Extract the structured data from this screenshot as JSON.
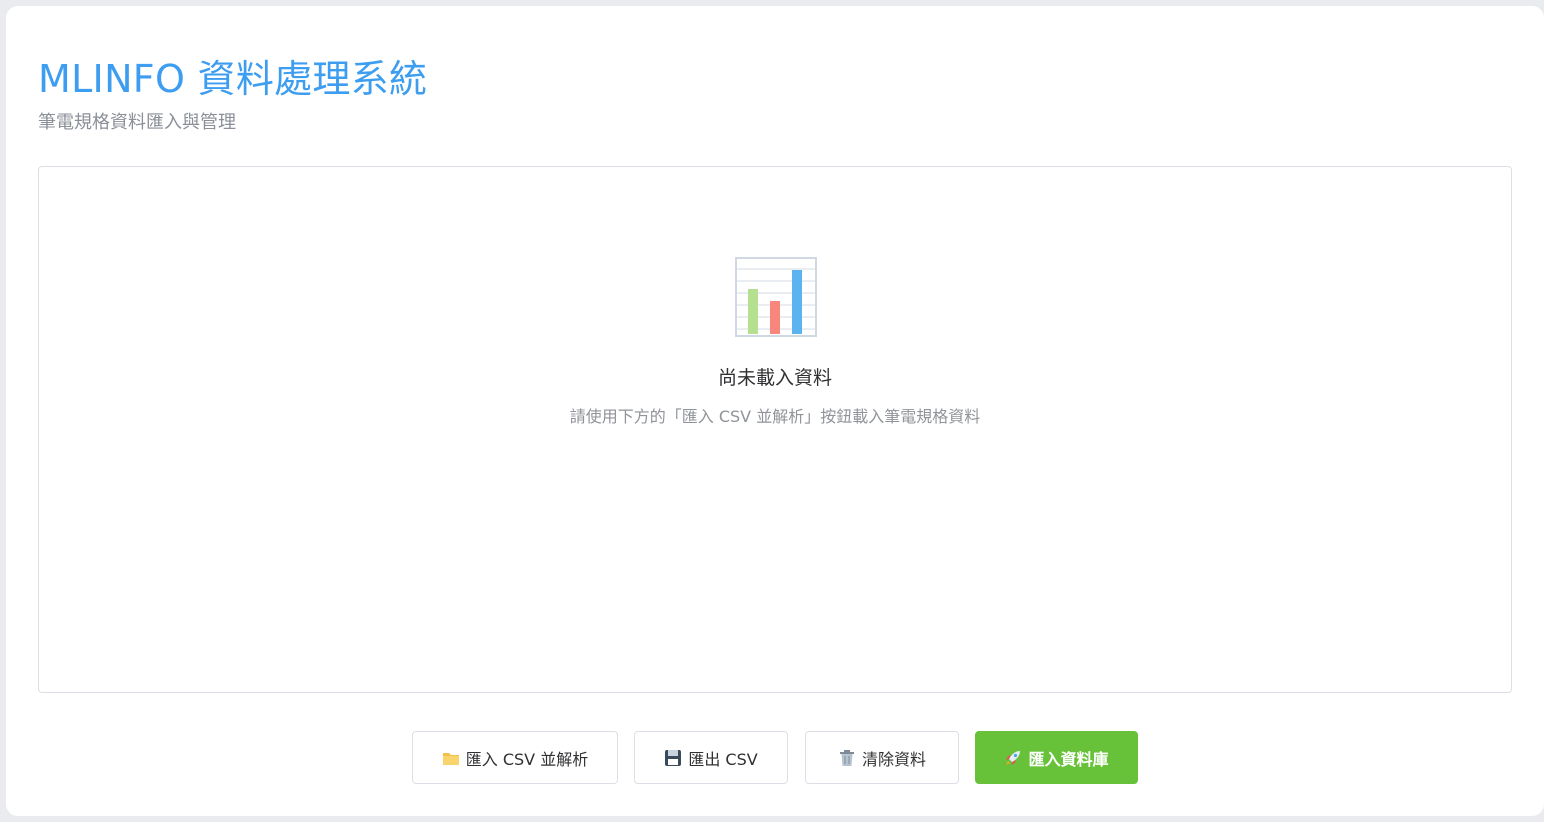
{
  "header": {
    "title": "MLINFO 資料處理系統",
    "subtitle": "筆電規格資料匯入與管理"
  },
  "empty_state": {
    "icon": "bar-chart-icon",
    "title": "尚未載入資料",
    "description": "請使用下方的「匯入 CSV 並解析」按鈕載入筆電規格資料"
  },
  "actions": {
    "import_csv": {
      "label": "匯入 CSV 並解析",
      "icon": "folder-icon"
    },
    "export_csv": {
      "label": "匯出 CSV",
      "icon": "floppy-disk-icon"
    },
    "clear_data": {
      "label": "清除資料",
      "icon": "trash-icon"
    },
    "import_db": {
      "label": "匯入資料庫",
      "icon": "rocket-icon"
    }
  },
  "colors": {
    "accent": "#3d9df0",
    "success": "#67c23a",
    "border": "#dcdfe6",
    "muted_text": "#909399"
  }
}
